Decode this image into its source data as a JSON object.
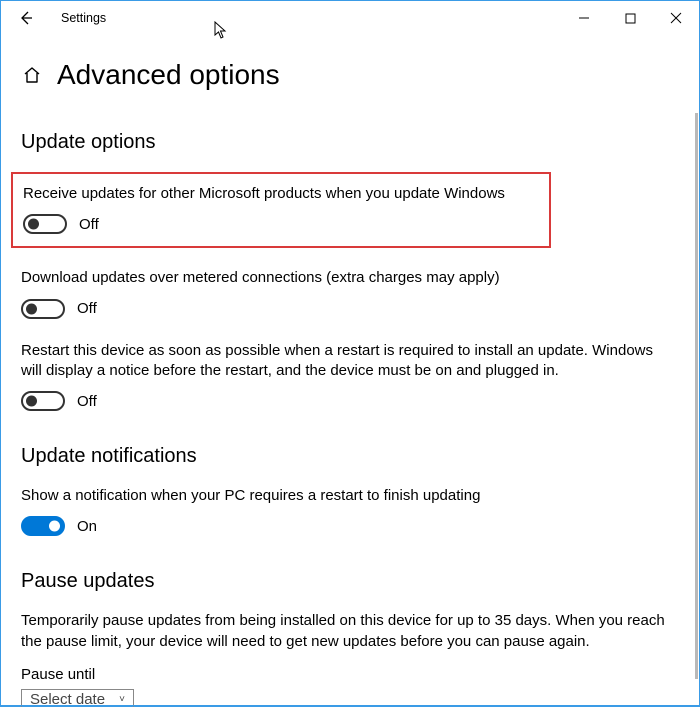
{
  "titlebar": {
    "title": "Settings"
  },
  "header": {
    "title": "Advanced options"
  },
  "sections": {
    "update_options": {
      "heading": "Update options",
      "receive": {
        "text": "Receive updates for other Microsoft products when you update Windows",
        "state": "Off"
      },
      "metered": {
        "text": "Download updates over metered connections (extra charges may apply)",
        "state": "Off"
      },
      "restart": {
        "text": "Restart this device as soon as possible when a restart is required to install an update. Windows will display a notice before the restart, and the device must be on and plugged in.",
        "state": "Off"
      }
    },
    "notifications": {
      "heading": "Update notifications",
      "show": {
        "text": "Show a notification when your PC requires a restart to finish updating",
        "state": "On"
      }
    },
    "pause": {
      "heading": "Pause updates",
      "desc": "Temporarily pause updates from being installed on this device for up to 35 days. When you reach the pause limit, your device will need to get new updates before you can pause again.",
      "until_label": "Pause until",
      "select_placeholder": "Select date"
    }
  }
}
